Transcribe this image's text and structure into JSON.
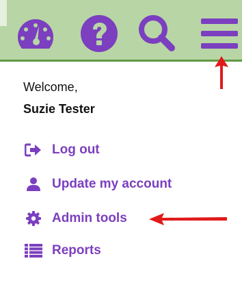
{
  "colors": {
    "accent": "#7b3fbf",
    "topbar_bg": "#b8d6a5",
    "topbar_border": "#5f9a42",
    "arrow": "#e11a1a"
  },
  "toolbar": {
    "icons": [
      "dashboard-icon",
      "help-icon",
      "search-icon",
      "menu-icon"
    ]
  },
  "user": {
    "welcome": "Welcome,",
    "name": "Suzie Tester"
  },
  "menu": {
    "items": [
      {
        "label": "Log out",
        "icon": "sign-out-icon"
      },
      {
        "label": "Update my account",
        "icon": "user-icon"
      },
      {
        "label": "Admin tools",
        "icon": "gear-icon"
      },
      {
        "label": "Reports",
        "icon": "list-icon"
      }
    ]
  }
}
